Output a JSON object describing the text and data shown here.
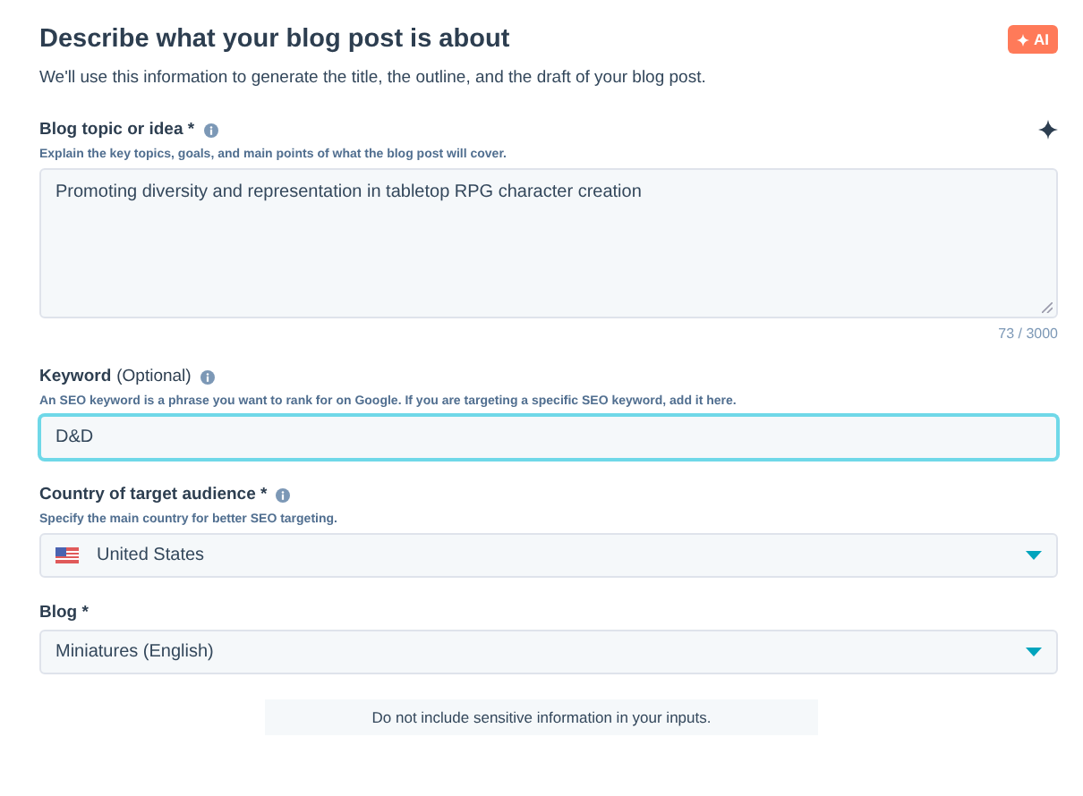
{
  "header": {
    "title": "Describe what your blog post is about",
    "badge": "AI",
    "subtitle": "We'll use this information to generate the title, the outline, and the draft of your blog post."
  },
  "fields": [
    {
      "kind": "textarea",
      "label": "Blog topic or idea *",
      "info": true,
      "sparkle": true,
      "help": "Explain the key topics, goals, and main points of what the blog post will cover.",
      "value": "Promoting diversity and representation in tabletop RPG character creation",
      "counter": "73 / 3000",
      "focused": false
    },
    {
      "kind": "input",
      "label": "Keyword",
      "note": "(Optional)",
      "info": true,
      "help": "An SEO keyword is a phrase you want to rank for on Google. If you are targeting a specific SEO keyword, add it here.",
      "value": "D&D",
      "focused": true
    },
    {
      "kind": "select",
      "label": "Country of target audience *",
      "info": true,
      "help": "Specify the main country for better SEO targeting.",
      "value": "United States",
      "flag": true,
      "focused": false
    },
    {
      "kind": "select",
      "label": "Blog *",
      "info": false,
      "value": "Miniatures (English)",
      "flag": false,
      "focused": false
    }
  ],
  "notice": "Do not include sensitive information in your inputs."
}
